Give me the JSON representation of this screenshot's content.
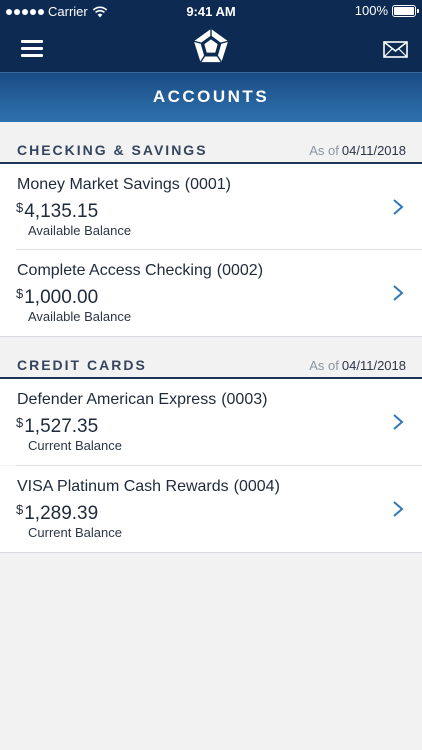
{
  "status_bar": {
    "carrier": "Carrier",
    "time": "9:41 AM",
    "battery": "100%"
  },
  "header": {
    "menu_icon": "hamburger-menu-icon",
    "logo_icon": "pentagon-logo-icon",
    "mail_icon": "envelope-icon",
    "title": "ACCOUNTS"
  },
  "colors": {
    "nav_background": "#0c2a52",
    "banner_gradient_top": "#1a4c86",
    "banner_gradient_bottom": "#2f72ad",
    "chevron": "#2f78b8"
  },
  "sections": [
    {
      "title": "CHECKING & SAVINGS",
      "as_of_label": "As of",
      "as_of_date": "04/11/2018",
      "accounts": [
        {
          "name": "Money Market Savings",
          "number": "(0001)",
          "currency": "$",
          "amount": "4,135.15",
          "balance_label": "Available Balance"
        },
        {
          "name": "Complete Access Checking",
          "number": "(0002)",
          "currency": "$",
          "amount": "1,000.00",
          "balance_label": "Available Balance"
        }
      ]
    },
    {
      "title": "CREDIT CARDS",
      "as_of_label": "As of",
      "as_of_date": "04/11/2018",
      "accounts": [
        {
          "name": "Defender American Express",
          "number": "(0003)",
          "currency": "$",
          "amount": "1,527.35",
          "balance_label": "Current Balance"
        },
        {
          "name": "VISA Platinum Cash Rewards",
          "number": "(0004)",
          "currency": "$",
          "amount": "1,289.39",
          "balance_label": "Current Balance"
        }
      ]
    }
  ]
}
